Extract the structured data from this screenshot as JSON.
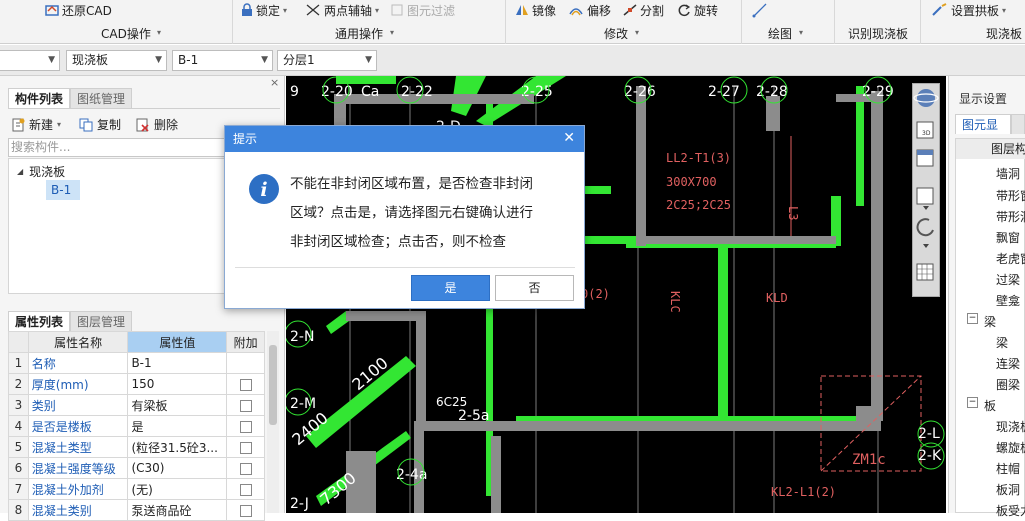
{
  "ribbon": {
    "restore_cad": "还原CAD",
    "group_cad": "CAD操作",
    "lock": "锁定",
    "two_point_axis": "两点辅轴",
    "element_filter": "图元过滤",
    "group_general": "通用操作",
    "mirror": "镜像",
    "offset": "偏移",
    "split": "分割",
    "rotate": "旋转",
    "group_modify": "修改",
    "group_draw": "绘图",
    "group_recognize": "识别现浇板",
    "set_arch": "设置拱板",
    "group_slab": "现浇板"
  },
  "selectors": {
    "type": "现浇板",
    "name": "B-1",
    "layer": "分层1"
  },
  "component_panel": {
    "tab_list": "构件列表",
    "tab_drawing": "图纸管理",
    "new": "新建",
    "copy": "复制",
    "delete": "删除",
    "search_placeholder": "搜索构件...",
    "tree_root": "现浇板",
    "tree_child": "B-1"
  },
  "property_panel": {
    "tab_props": "属性列表",
    "tab_layers": "图层管理",
    "col_name": "属性名称",
    "col_value": "属性值",
    "col_extra": "附加",
    "rows": [
      {
        "num": "1",
        "name": "名称",
        "value": "B-1"
      },
      {
        "num": "2",
        "name": "厚度(mm)",
        "value": "150"
      },
      {
        "num": "3",
        "name": "类别",
        "value": "有梁板"
      },
      {
        "num": "4",
        "name": "是否是楼板",
        "value": "是"
      },
      {
        "num": "5",
        "name": "混凝土类型",
        "value": "(粒径31.5砼3..."
      },
      {
        "num": "6",
        "name": "混凝土强度等级",
        "value": "(C30)"
      },
      {
        "num": "7",
        "name": "混凝土外加剂",
        "value": "(无)"
      },
      {
        "num": "8",
        "name": "混凝土类别",
        "value": "泵送商品砼"
      }
    ]
  },
  "display_panel": {
    "title": "显示设置",
    "tab_display": "图元显示",
    "header": "图层构",
    "items": [
      "墙洞",
      "带形窗",
      "带形洞",
      "飘窗",
      "老虎窗",
      "过梁",
      "壁龛"
    ],
    "group_beam": "梁",
    "beam_items": [
      "梁",
      "连梁",
      "圈梁"
    ],
    "group_slab": "板",
    "slab_items": [
      "现浇板",
      "螺旋板",
      "柱帽",
      "板洞",
      "板受力"
    ]
  },
  "drawing": {
    "axes": [
      "9",
      "2-20",
      "Ca",
      "2-22",
      "2-25",
      "2-26",
      "2-27",
      "2-28",
      "2-29",
      "2-N",
      "2-M",
      "2-L",
      "2-K",
      "2-J",
      "2-4a",
      "2-5a",
      "2-D"
    ],
    "beam_label_1": "LL2-T1(3)",
    "beam_label_2": "300X700",
    "beam_label_3": "2C25;2C25",
    "beam_label_4": "L3",
    "beam_label_5": "KLD",
    "beam_label_6": "KLC",
    "beam_label_7": "KL2-L1(2)",
    "beam_label_8": "6C25",
    "beam_label_9": "ZM1c",
    "beam_label_10": "0(2)",
    "dim_1": "2100",
    "dim_2": "2400",
    "dim_3": "7300",
    "colors": {
      "background": "#000000",
      "beam": "#33e633",
      "wall": "#8c8c8c",
      "text": "#e06060",
      "axis": "#ffffff"
    }
  },
  "dialog": {
    "title": "提示",
    "message_line1": "不能在非封闭区域布置，是否检查非封闭",
    "message_line2": "区域？点击是，请选择图元右键确认进行",
    "message_line3": "非封闭区域检查；点击否，则不检查",
    "yes": "是",
    "no": "否"
  }
}
